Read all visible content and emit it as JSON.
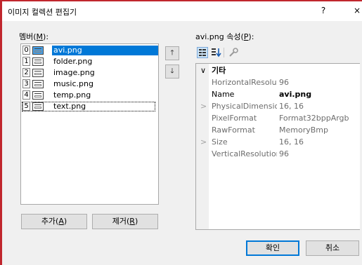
{
  "window": {
    "title": "이미지 컬렉션 편집기",
    "help": "?",
    "close": "×"
  },
  "members": {
    "label_prefix": "멤버(",
    "label_key": "M",
    "label_suffix": "):",
    "items": [
      {
        "index": "0",
        "name": "avi.png",
        "selected": true,
        "icon": "image-file-icon"
      },
      {
        "index": "1",
        "name": "folder.png",
        "selected": false,
        "icon": "image-file-icon"
      },
      {
        "index": "2",
        "name": "image.png",
        "selected": false,
        "icon": "image-file-icon"
      },
      {
        "index": "3",
        "name": "music.png",
        "selected": false,
        "icon": "image-file-icon"
      },
      {
        "index": "4",
        "name": "temp.png",
        "selected": false,
        "icon": "image-file-icon"
      },
      {
        "index": "5",
        "name": "text.png",
        "selected": false,
        "icon": "image-file-icon",
        "focused": true
      }
    ],
    "move_up": "🡑",
    "move_down": "🡓",
    "add_prefix": "추가(",
    "add_key": "A",
    "add_suffix": ")",
    "remove_prefix": "제거(",
    "remove_key": "R",
    "remove_suffix": ")"
  },
  "properties": {
    "label_prefix": "avi.png 속성(",
    "label_key": "P",
    "label_suffix": "):",
    "toolbar": {
      "categorized": "categorized-view-icon",
      "alphabetical": "alphabetical-sort-icon",
      "property_pages": "wrench-icon"
    },
    "category": {
      "expander": "∨",
      "name": "기타"
    },
    "rows": [
      {
        "name": "HorizontalResolution",
        "value": "96",
        "expander": "",
        "active": false
      },
      {
        "name": "Name",
        "value": "avi.png",
        "expander": "",
        "active": true
      },
      {
        "name": "PhysicalDimension",
        "value": "16, 16",
        "expander": ">",
        "active": false
      },
      {
        "name": "PixelFormat",
        "value": "Format32bppArgb",
        "expander": "",
        "active": false
      },
      {
        "name": "RawFormat",
        "value": "MemoryBmp",
        "expander": "",
        "active": false
      },
      {
        "name": "Size",
        "value": "16, 16",
        "expander": ">",
        "active": false
      },
      {
        "name": "VerticalResolution",
        "value": "96",
        "expander": "",
        "active": false
      }
    ]
  },
  "footer": {
    "ok": "확인",
    "cancel": "취소"
  },
  "colors": {
    "selection": "#0078d7",
    "frame_accent": "#c0262d"
  }
}
